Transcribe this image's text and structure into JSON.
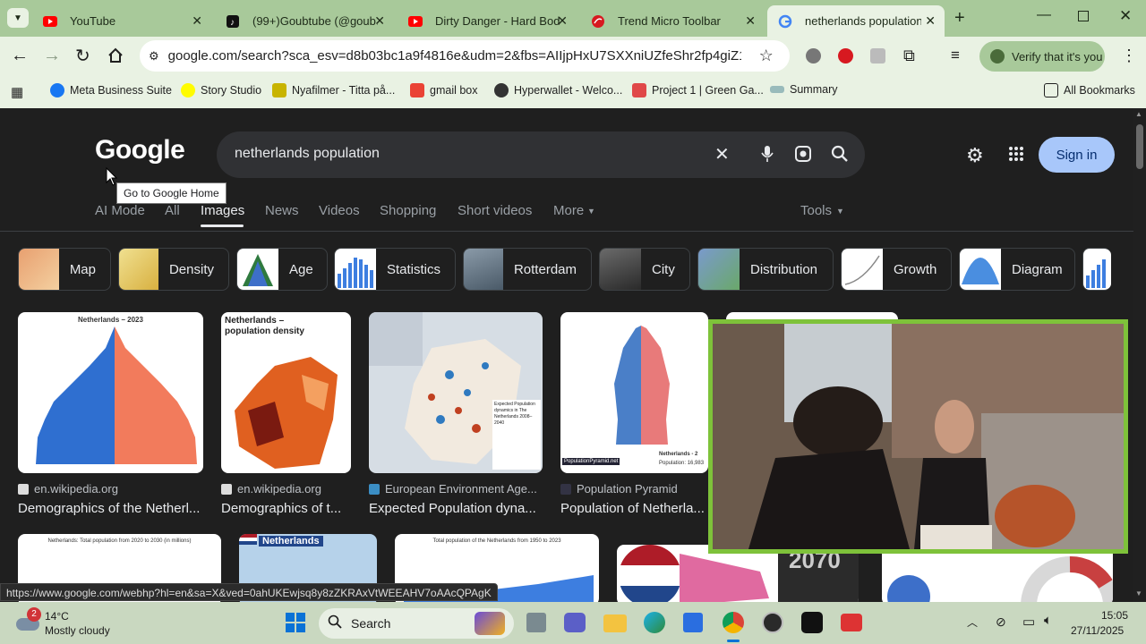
{
  "browser": {
    "tabs": [
      {
        "label": "YouTube",
        "icon": "youtube-icon"
      },
      {
        "label": "(99+)Goubtube (@goub…",
        "icon": "tiktok-icon"
      },
      {
        "label": "Dirty Danger - Hard Bod…",
        "icon": "youtube-icon"
      },
      {
        "label": "Trend Micro Toolbar",
        "icon": "trend-micro-icon"
      },
      {
        "label": "netherlands population",
        "icon": "google-icon"
      }
    ],
    "url": "google.com/search?sca_esv=d8b03bc1a9f4816e&udm=2&fbs=AIIjpHxU7SXXniUZfeShr2fp4giZ1Y6MJ...",
    "verify_label": "Verify that it's you",
    "bookmarks": [
      "Meta Business Suite",
      "Story Studio",
      "Nyafilmer - Titta på...",
      "gmail box",
      "Hyperwallet - Welco...",
      "Project 1 | Green Ga...",
      "Summary"
    ],
    "all_bookmarks": "All Bookmarks"
  },
  "google": {
    "logo": "Google",
    "query": "netherlands population",
    "tooltip": "Go to Google Home",
    "sign_in": "Sign in",
    "nav": [
      "AI Mode",
      "All",
      "Images",
      "News",
      "Videos",
      "Shopping",
      "Short videos",
      "More"
    ],
    "tools": "Tools",
    "chips": [
      "Map",
      "Density",
      "Age",
      "Statistics",
      "Rotterdam",
      "City",
      "Distribution",
      "Growth",
      "Diagram"
    ],
    "results": [
      {
        "source": "en.wikipedia.org",
        "caption": "Demographics of the Netherl...",
        "img_title": "Netherlands – 2023"
      },
      {
        "source": "en.wikipedia.org",
        "caption": "Demographics of t...",
        "img_title": "Netherlands – population density"
      },
      {
        "source": "European Environment Age...",
        "caption": "Expected Population dyna...",
        "img_title": "Expected Population dynamics in The Netherlands 2008–2040"
      },
      {
        "source": "Population Pyramid",
        "caption": "Population of Netherla...",
        "img_title": "Netherlands - 2",
        "img_sub": "Population: 16,983",
        "img_tag": "PopulationPyramid.net"
      }
    ],
    "row2": {
      "img1_title": "Netherlands: Total population from 2020 to 2030 (in millions)",
      "img2_title": "Netherlands",
      "img3_title": "Total population of the Netherlands from 1950 to 2023",
      "img5_year": "2070"
    },
    "status_url": "https://www.google.com/webhp?hl=en&sa=X&ved=0ahUKEwjsq8y8zZKRAxVtWEEAHV7oAAcQPAgK"
  },
  "taskbar": {
    "weather_temp": "14°C",
    "weather_desc": "Mostly cloudy",
    "weather_badge": "2",
    "search_label": "Search",
    "time": "15:05",
    "date": "27/11/2025"
  }
}
